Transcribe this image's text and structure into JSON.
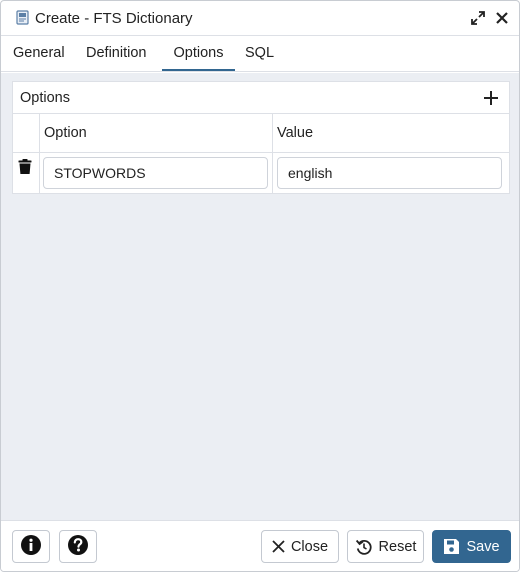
{
  "dialog": {
    "title": "Create - FTS Dictionary",
    "icons": {
      "title": "dictionary-icon",
      "expand": "expand-icon",
      "close": "close-icon"
    }
  },
  "tabs": [
    {
      "label": "General",
      "active": false
    },
    {
      "label": "Definition",
      "active": false
    },
    {
      "label": "Options",
      "active": true
    },
    {
      "label": "SQL",
      "active": false
    }
  ],
  "options_panel": {
    "title": "Options",
    "add_icon": "plus-icon",
    "columns": [
      "Option",
      "Value"
    ],
    "rows": [
      {
        "option": "STOPWORDS",
        "value": "english",
        "delete_icon": "trash-icon"
      }
    ]
  },
  "footer": {
    "info_icon": "info-icon",
    "help_icon": "help-icon",
    "close_label": "Close",
    "reset_label": "Reset",
    "save_label": "Save"
  },
  "colors": {
    "accent": "#326690",
    "background": "#ebeef3",
    "border": "#dde0e6"
  }
}
